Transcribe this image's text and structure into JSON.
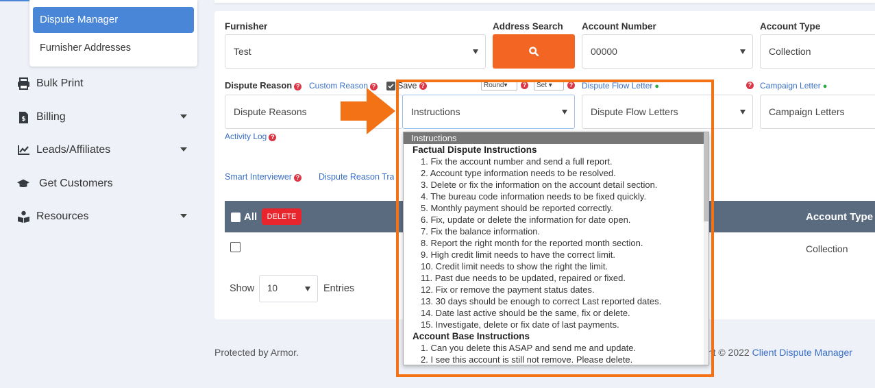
{
  "sidebar": {
    "submenu": {
      "active": "Dispute Manager",
      "item": "Furnisher Addresses"
    },
    "items": [
      {
        "label": "Bulk Print",
        "icon": "printer-icon",
        "has_caret": false
      },
      {
        "label": "Billing",
        "icon": "invoice-icon",
        "has_caret": true
      },
      {
        "label": "Leads/Affiliates",
        "icon": "chart-icon",
        "has_caret": true
      },
      {
        "label": "Get Customers",
        "icon": "graduation-cap-icon",
        "has_caret": false
      },
      {
        "label": "Resources",
        "icon": "book-reader-icon",
        "has_caret": true
      }
    ]
  },
  "form": {
    "furnisher": {
      "label": "Furnisher",
      "value": "Test"
    },
    "address_search": {
      "label": "Address Search",
      "icon": "search-icon"
    },
    "account_number": {
      "label": "Account Number",
      "value": "00000"
    },
    "account_type": {
      "label": "Account Type",
      "value": "Collection"
    },
    "dispute_reason": {
      "label": "Dispute Reason",
      "value": "Dispute Reasons"
    },
    "custom_reason_link": "Custom Reason",
    "save_label": "Save",
    "round_select": "Round",
    "set_select": "Set",
    "instructions": {
      "value": "Instructions"
    },
    "dispute_flow": {
      "link": "Dispute Flow Letter",
      "value": "Dispute Flow Letters"
    },
    "campaign": {
      "link": "Campaign Letter",
      "value": "Campaign Letters"
    },
    "activity_log": "Activity Log",
    "smart_interviewer": "Smart Interviewer",
    "dispute_reason_truncated": "Dispute Reason Tra"
  },
  "table": {
    "all_label": "All",
    "delete_label": "DELETE",
    "account_type_header": "Account Type",
    "rows": [
      {
        "account_type": "Collection"
      }
    ]
  },
  "pagination": {
    "show_label": "Show",
    "entries_value": "10",
    "entries_label": "Entries"
  },
  "footer": {
    "left": "Protected by Armor.",
    "right_prefix": "ght © 2022 ",
    "right_link": "Client Dispute Manager"
  },
  "dropdown": {
    "selected": "Instructions",
    "groups": [
      {
        "title": "Factual Dispute Instructions",
        "options": [
          "1. Fix the account number and send a full report.",
          "2. Account type information needs to be resolved.",
          "3. Delete or fix the information on the account detail section.",
          "4. The bureau code information needs to be fixed quickly.",
          "5. Monthly payment should be reported correctly.",
          "6. Fix, update or delete the information for date open.",
          "7. Fix the balance information.",
          "8. Report the right month for the reported month section.",
          "9. High credit limit needs to have the correct limit.",
          "10. Credit limit needs to show the right the limit.",
          "11. Past due needs to be updated, repaired or fixed.",
          "12. Fix or remove the payment status dates.",
          "13. 30 days should be enough to correct Last reported dates.",
          "14. Date last active should be the same, fix or delete.",
          "15. Investigate, delete or fix date of last payments."
        ]
      },
      {
        "title": "Account Base Instructions",
        "options": [
          "1. Can you delete this ASAP and send me and update.",
          "2. I see this account is still not remove. Please delete."
        ]
      }
    ]
  },
  "colors": {
    "accent": "#4a86d8",
    "search_button": "#f26522",
    "highlight": "#f47216",
    "delete": "#e8252d",
    "table_header": "#5a6b80"
  }
}
